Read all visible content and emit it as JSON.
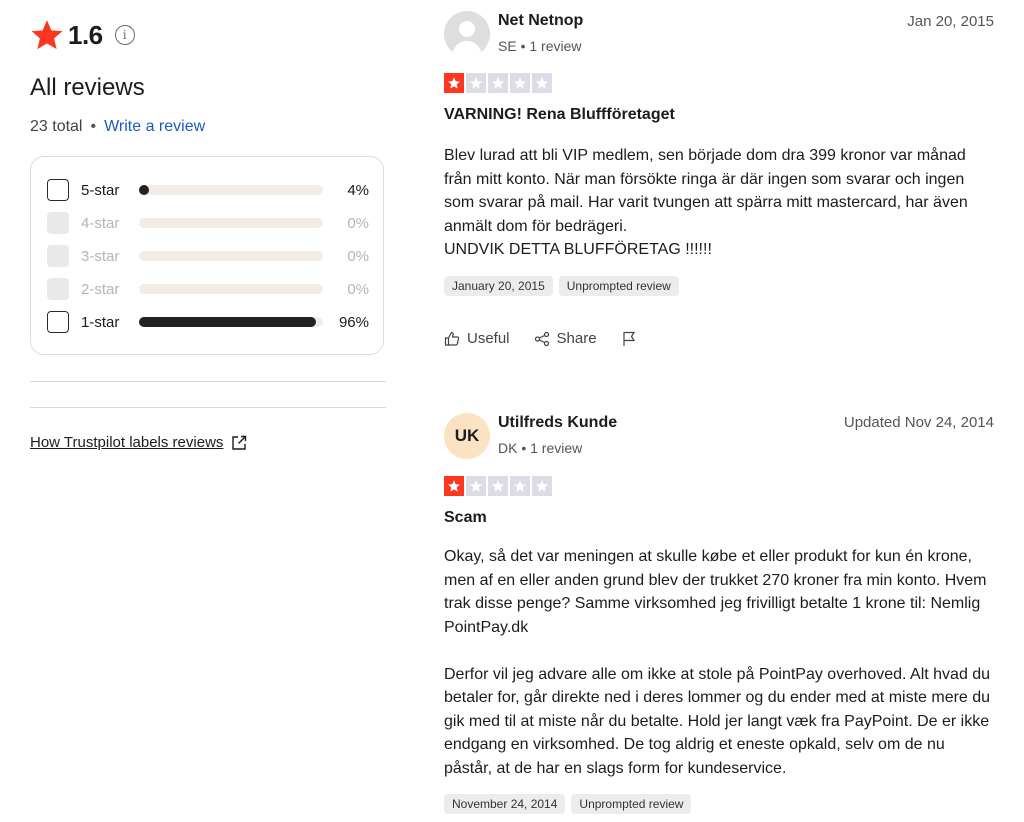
{
  "summary": {
    "rating": "1.6",
    "heading": "All reviews",
    "total": "23 total",
    "write_link": "Write a review",
    "star_color": "#ff3722"
  },
  "filters": [
    {
      "label": "5-star",
      "percent": "4%",
      "fraction": 0.04,
      "enabled": true
    },
    {
      "label": "4-star",
      "percent": "0%",
      "fraction": 0,
      "enabled": false
    },
    {
      "label": "3-star",
      "percent": "0%",
      "fraction": 0,
      "enabled": false
    },
    {
      "label": "2-star",
      "percent": "0%",
      "fraction": 0,
      "enabled": false
    },
    {
      "label": "1-star",
      "percent": "96%",
      "fraction": 0.96,
      "enabled": true
    }
  ],
  "labels_link": "How Trustpilot labels reviews",
  "reviews": [
    {
      "name": "Net Netnop",
      "meta": "SE • 1 review",
      "date": "Jan 20, 2015",
      "avatar_initials": "",
      "stars": 1,
      "title": "VARNING! Rena Bluffföretaget",
      "body": "Blev lurad att bli VIP medlem, sen började dom dra 399 kronor var månad från mitt konto. När man försökte ringa är där ingen som svarar och ingen som svarar på mail. Har varit tvungen att spärra mitt mastercard, har även anmält dom för bedrägeri.\nUNDVIK DETTA BLUFFÖRETAG !!!!!!",
      "tags": [
        "January 20, 2015",
        "Unprompted review"
      ],
      "actions": {
        "useful": "Useful",
        "share": "Share"
      }
    },
    {
      "name": "Utilfreds Kunde",
      "meta": "DK • 1 review",
      "date": "Updated Nov 24, 2014",
      "avatar_initials": "UK",
      "stars": 1,
      "title": "Scam",
      "body": "Okay, så det var meningen at skulle købe et eller produkt for kun én krone, men af en eller anden grund blev der trukket 270 kroner fra min konto. Hvem trak disse penge? Samme virksomhed jeg frivilligt betalte 1 krone til: Nemlig PointPay.dk\n\nDerfor vil jeg advare alle om ikke at stole på PointPay overhoved. Alt hvad du betaler for, går direkte ned i deres lommer og du ender med at miste mere du gik med til at miste når du betalte. Hold jer langt væk fra PayPoint. De er ikke endgang en virksomhed. De tog aldrig et eneste opkald, selv om de nu påstår, at de har en slags form for kundeservice.",
      "tags": [
        "November 24, 2014",
        "Unprompted review"
      ]
    }
  ]
}
